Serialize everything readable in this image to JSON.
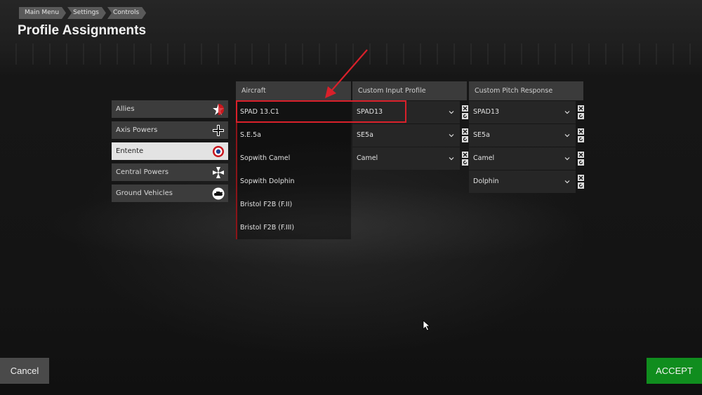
{
  "breadcrumb": [
    "Main Menu",
    "Settings",
    "Controls"
  ],
  "title": "Profile Assignments",
  "factions": [
    {
      "label": "Allies",
      "icon": "allies-star-icon"
    },
    {
      "label": "Axis Powers",
      "icon": "iron-cross-icon"
    },
    {
      "label": "Entente",
      "icon": "roundel-icon",
      "selected": true
    },
    {
      "label": "Central Powers",
      "icon": "cross-pattee-icon"
    },
    {
      "label": "Ground Vehicles",
      "icon": "tank-icon"
    }
  ],
  "columns": {
    "aircraft": "Aircraft",
    "input_profile": "Custom Input Profile",
    "pitch_response": "Custom Pitch Response"
  },
  "aircraft": [
    "SPAD 13.C1",
    "S.E.5a",
    "Sopwith Camel",
    "Sopwith Dolphin",
    "Bristol F2B (F.II)",
    "Bristol F2B (F.III)"
  ],
  "input_profiles": [
    "SPAD13",
    "SE5a",
    "Camel"
  ],
  "pitch_responses": [
    "SPAD13",
    "SE5a",
    "Camel",
    "Dolphin"
  ],
  "buttons": {
    "cancel": "Cancel",
    "accept": "ACCEPT"
  },
  "colors": {
    "accent_red": "#d9202a",
    "accept_green": "#108d1e",
    "selected_faction": "#e3e3e3"
  }
}
